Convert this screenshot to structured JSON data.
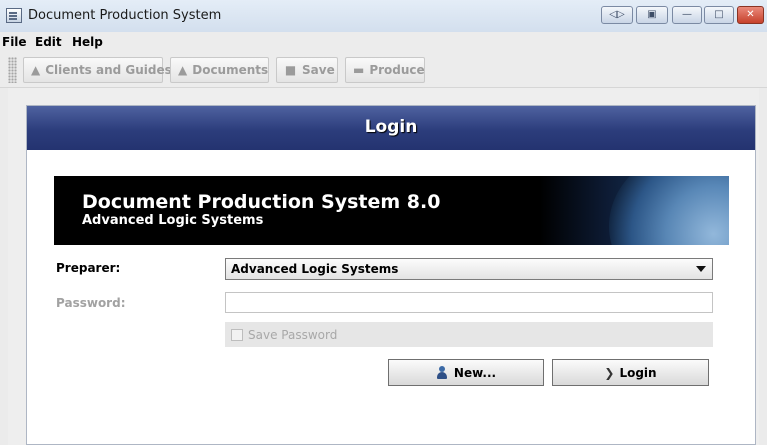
{
  "window": {
    "title": "Document Production System"
  },
  "menu": [
    "File",
    "Edit",
    "Help"
  ],
  "toolbar": {
    "clients_label": "Clients and Guides",
    "documents_label": "Documents",
    "save_label": "Save",
    "produce_label": "Produce"
  },
  "panel": {
    "header": "Login"
  },
  "banner": {
    "title": "Document Production System 8.0",
    "subtitle": "Advanced Logic Systems"
  },
  "form": {
    "preparer_label": "Preparer:",
    "preparer_value": "Advanced Logic Systems",
    "password_label": "Password:",
    "password_value": "",
    "save_password_label": "Save Password",
    "save_password_checked": false,
    "new_button": "New...",
    "login_button": "Login"
  },
  "icons": {
    "app": "app-icon",
    "new": "user-icon",
    "login": "chevron-right-icon"
  }
}
